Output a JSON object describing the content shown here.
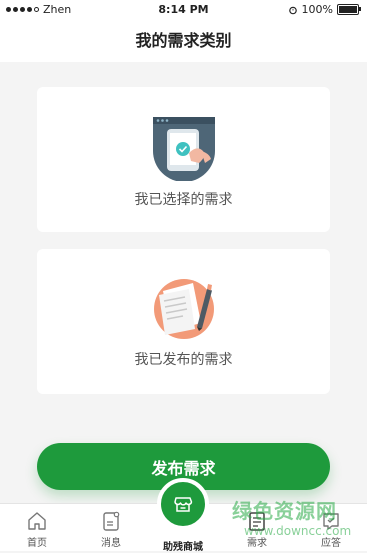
{
  "status_bar": {
    "carrier": "Zhen",
    "time": "8:14 PM",
    "battery": "100%"
  },
  "header": {
    "title": "我的需求类别"
  },
  "cards": [
    {
      "label": "我已选择的需求",
      "icon": "tablet-hand-icon"
    },
    {
      "label": "我已发布的需求",
      "icon": "document-pen-icon"
    }
  ],
  "publish_button": {
    "label": "发布需求"
  },
  "tabbar": {
    "items": [
      {
        "label": "首页",
        "icon": "home-icon"
      },
      {
        "label": "消息",
        "icon": "message-icon"
      },
      {
        "label": "助残商城",
        "icon": "store-icon"
      },
      {
        "label": "需求",
        "icon": "demand-icon"
      },
      {
        "label": "应答",
        "icon": "answer-icon"
      }
    ]
  },
  "watermark": {
    "title": "绿色资源网",
    "url": "www.downcc.com"
  },
  "colors": {
    "brand_green": "#1e9a3c",
    "background": "#f4f4f4"
  }
}
